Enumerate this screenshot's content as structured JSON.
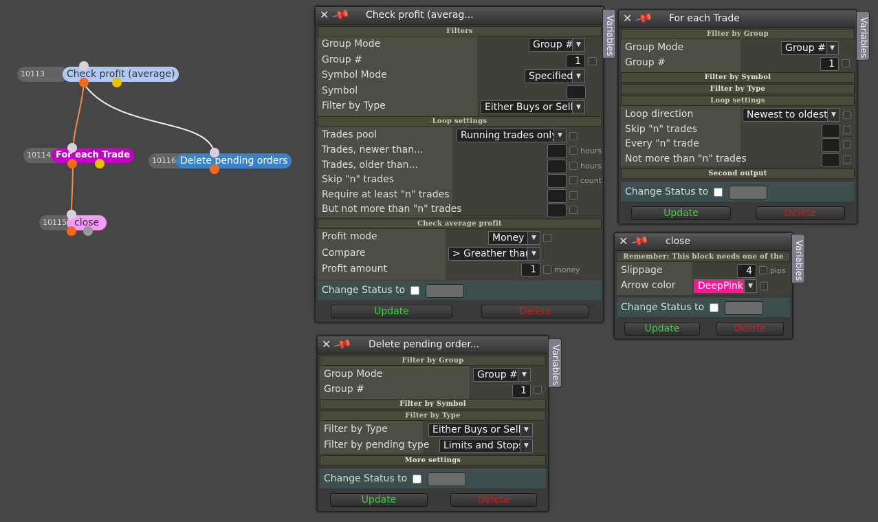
{
  "graph": {
    "nodes": [
      {
        "id": "10113",
        "label": "Check profit (average)"
      },
      {
        "id": "10114",
        "label": "For each Trade"
      },
      {
        "id": "10116",
        "label": "Delete pending orders"
      },
      {
        "id": "10115",
        "label": "close"
      }
    ],
    "colors": {
      "check_profit": "#b0c8f4",
      "for_each": "#c400c4",
      "delete_pending": "#3b82c4",
      "close": "#f59af5",
      "link_orange": "#f08a4a",
      "link_white": "#f3eee6"
    }
  },
  "common": {
    "variables": "Variables",
    "update": "Update",
    "delete": "Delete",
    "change_status": "Change Status to",
    "close_icon": "✕",
    "pin_icon": "📌"
  },
  "check_profit": {
    "title": "Check profit (averag...",
    "sections": {
      "filters": "Filters",
      "loop": "Loop settings",
      "avg": "Check average profit"
    },
    "rows": {
      "group_mode": "Group Mode",
      "group_num": "Group #",
      "symbol_mode": "Symbol Mode",
      "symbol": "Symbol",
      "filter_type": "Filter by Type",
      "trades_pool": "Trades pool",
      "newer": "Trades, newer than...",
      "older": "Trades, older than...",
      "skip": "Skip \"n\" trades",
      "require": "Require at least \"n\" trades",
      "not_more": "But not more than \"n\" trades",
      "profit_mode": "Profit mode",
      "compare": "Compare",
      "profit_amount": "Profit amount"
    },
    "values": {
      "group_mode": "Group #",
      "group_num": "1",
      "symbol_mode": "Specified",
      "filter_type": "Either Buys or Sells",
      "trades_pool": "Running trades only",
      "profit_mode": "Money",
      "compare": "> Greather than",
      "profit_amount": "1"
    },
    "units": {
      "hours1": "hours",
      "hours2": "hours",
      "count": "count",
      "money": "money"
    }
  },
  "for_each": {
    "title": "For each Trade",
    "sections": {
      "group": "Filter by Group",
      "symbol": "Filter by Symbol",
      "type": "Filter by Type",
      "loop": "Loop settings",
      "second": "Second output"
    },
    "rows": {
      "group_mode": "Group Mode",
      "group_num": "Group #",
      "loop_dir": "Loop direction",
      "skip": "Skip \"n\" trades",
      "every": "Every \"n\" trade",
      "not_more": "Not more than \"n\" trades"
    },
    "values": {
      "group_mode": "Group #",
      "group_num": "1",
      "loop_dir": "Newest to oldest"
    }
  },
  "close": {
    "title": "close",
    "note": "Remember: This block needs one of the",
    "rows": {
      "slippage": "Slippage",
      "arrow": "Arrow color"
    },
    "values": {
      "slippage": "4",
      "arrow": "DeepPink"
    },
    "units": {
      "pips": "pips"
    },
    "arrow_color": "#ff1493"
  },
  "delete_pending": {
    "title": "Delete pending order...",
    "sections": {
      "group": "Filter by Group",
      "symbol": "Filter by Symbol",
      "type": "Filter by Type",
      "more": "More settings"
    },
    "rows": {
      "group_mode": "Group Mode",
      "group_num": "Group #",
      "filter_type": "Filter by Type",
      "pending_type": "Filter by pending type"
    },
    "values": {
      "group_mode": "Group #",
      "group_num": "1",
      "filter_type": "Either Buys or Sells",
      "pending_type": "Limits and Stops"
    }
  }
}
